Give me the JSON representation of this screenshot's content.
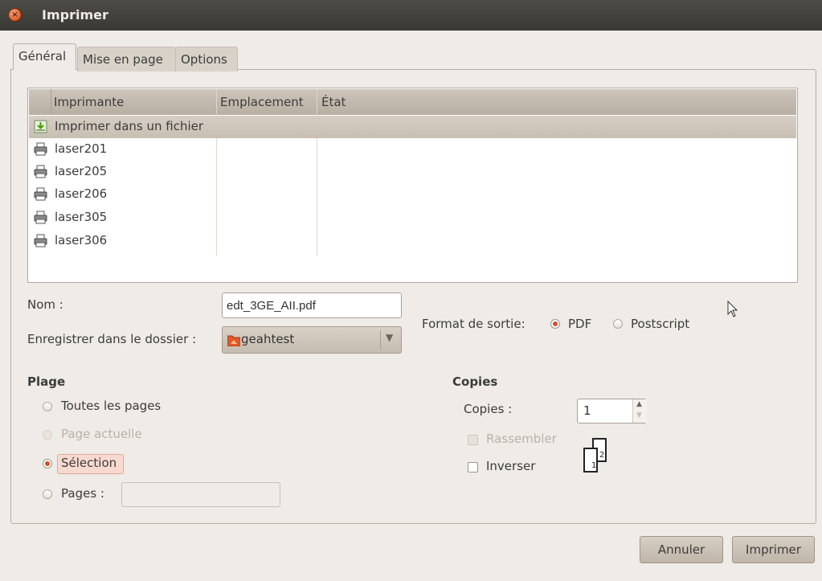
{
  "window": {
    "title": "Imprimer"
  },
  "tabs": [
    {
      "label": "Général",
      "active": true
    },
    {
      "label": "Mise en page",
      "active": false
    },
    {
      "label": "Options",
      "active": false
    }
  ],
  "printer_list": {
    "columns": [
      "Imprimante",
      "Emplacement",
      "État"
    ],
    "rows": [
      {
        "name": "Imprimer dans un fichier",
        "icon": "save-to-file-icon",
        "selected": true
      },
      {
        "name": "laser201",
        "icon": "printer-icon",
        "selected": false
      },
      {
        "name": "laser205",
        "icon": "printer-icon",
        "selected": false
      },
      {
        "name": "laser206",
        "icon": "printer-icon",
        "selected": false
      },
      {
        "name": "laser305",
        "icon": "printer-icon",
        "selected": false
      },
      {
        "name": "laser306",
        "icon": "printer-icon",
        "selected": false
      }
    ]
  },
  "file": {
    "name_label": "Nom :",
    "name_value": "edt_3GE_AII.pdf",
    "folder_label": "Enregistrer dans le dossier :",
    "folder_value": "geahtest",
    "format_label": "Format de sortie:",
    "format_options": [
      "PDF",
      "Postscript"
    ],
    "format_selected": "PDF"
  },
  "range": {
    "title": "Plage",
    "options": [
      {
        "label": "Toutes les pages",
        "state": "off"
      },
      {
        "label": "Page actuelle",
        "state": "disabled"
      },
      {
        "label": "Sélection",
        "state": "on"
      },
      {
        "label": "Pages :",
        "state": "off"
      }
    ],
    "pages_value": ""
  },
  "copies": {
    "title": "Copies",
    "copies_label": "Copies :",
    "copies_value": "1",
    "collate_label": "Rassembler",
    "collate_disabled": true,
    "reverse_label": "Inverser",
    "reverse_checked": false,
    "diagram_pages": [
      "1",
      "2"
    ]
  },
  "buttons": {
    "cancel": "Annuler",
    "print": "Imprimer"
  },
  "colors": {
    "accent_radio": "#d94a2b",
    "titlebar": "#3a3935",
    "folder_icon": "#e0582a"
  }
}
